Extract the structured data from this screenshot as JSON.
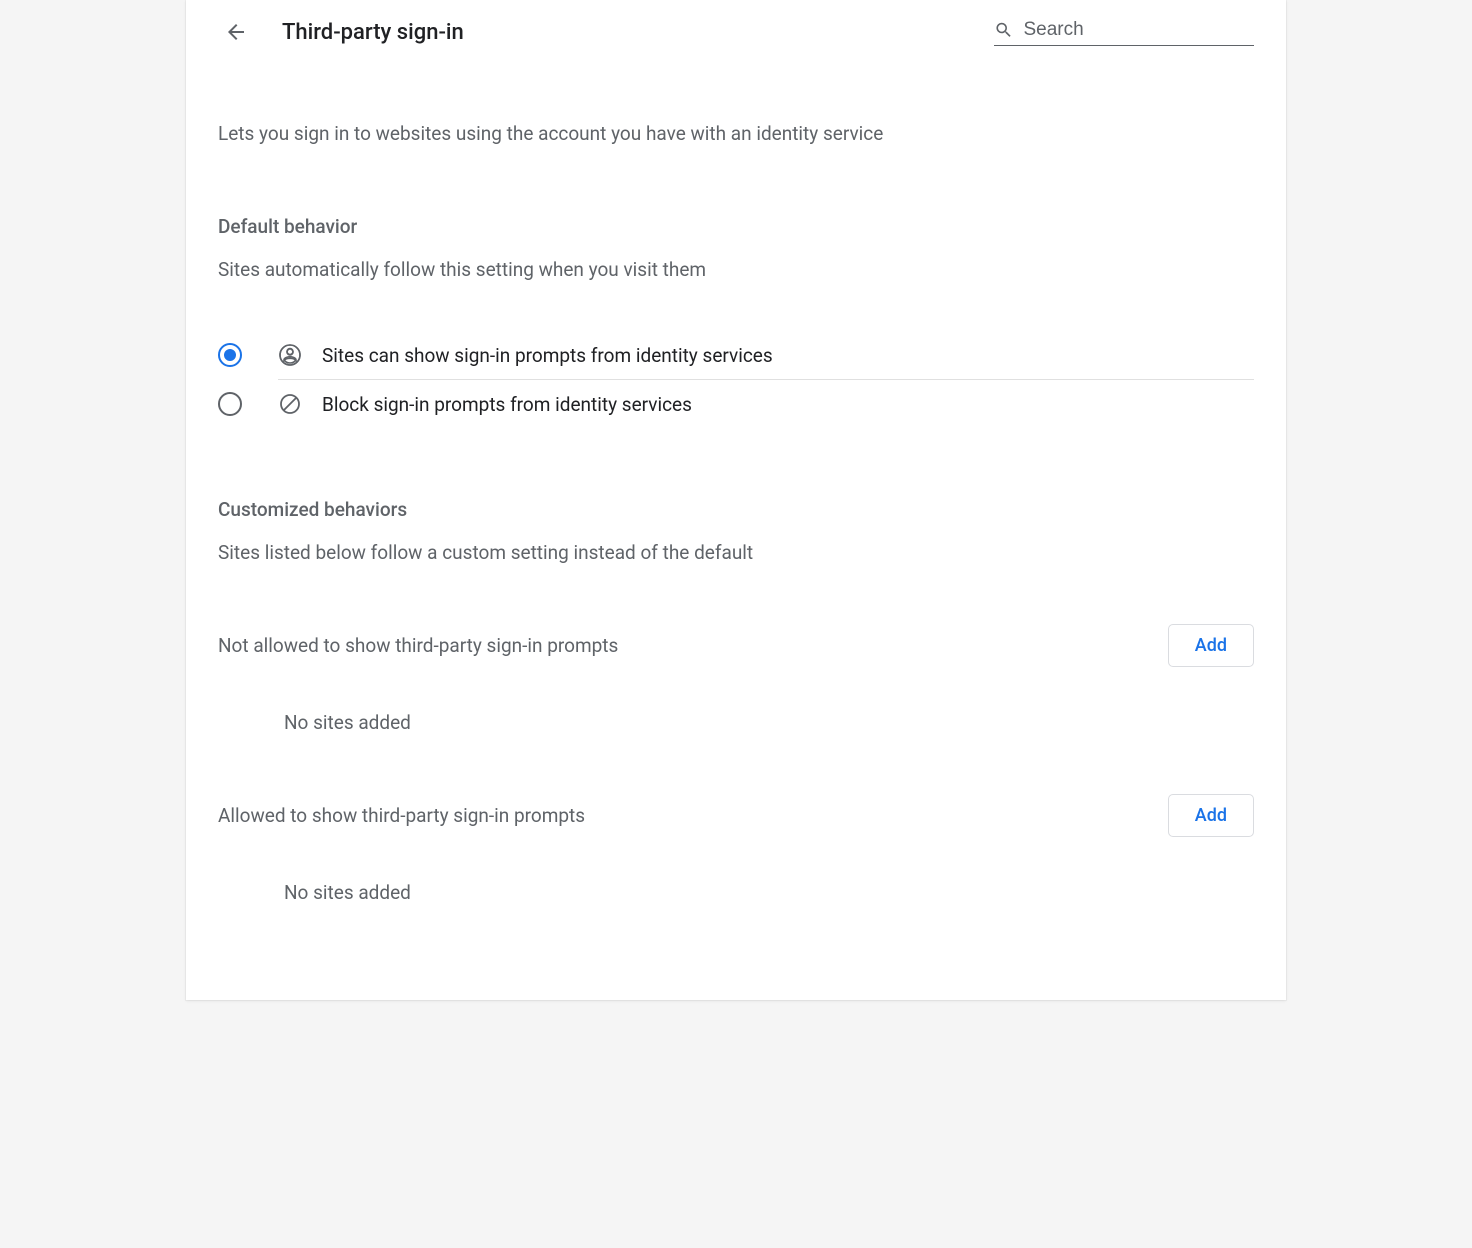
{
  "header": {
    "title": "Third-party sign-in",
    "search_placeholder": "Search"
  },
  "description": "Lets you sign in to websites using the account you have with an identity service",
  "default_section": {
    "heading": "Default behavior",
    "subtext": "Sites automatically follow this setting when you visit them",
    "options": [
      {
        "label": "Sites can show sign-in prompts from identity services",
        "selected": true
      },
      {
        "label": "Block sign-in prompts from identity services",
        "selected": false
      }
    ]
  },
  "custom_section": {
    "heading": "Customized behaviors",
    "subtext": "Sites listed below follow a custom setting instead of the default",
    "not_allowed": {
      "label": "Not allowed to show third-party sign-in prompts",
      "add_label": "Add",
      "empty_text": "No sites added"
    },
    "allowed": {
      "label": "Allowed to show third-party sign-in prompts",
      "add_label": "Add",
      "empty_text": "No sites added"
    }
  }
}
